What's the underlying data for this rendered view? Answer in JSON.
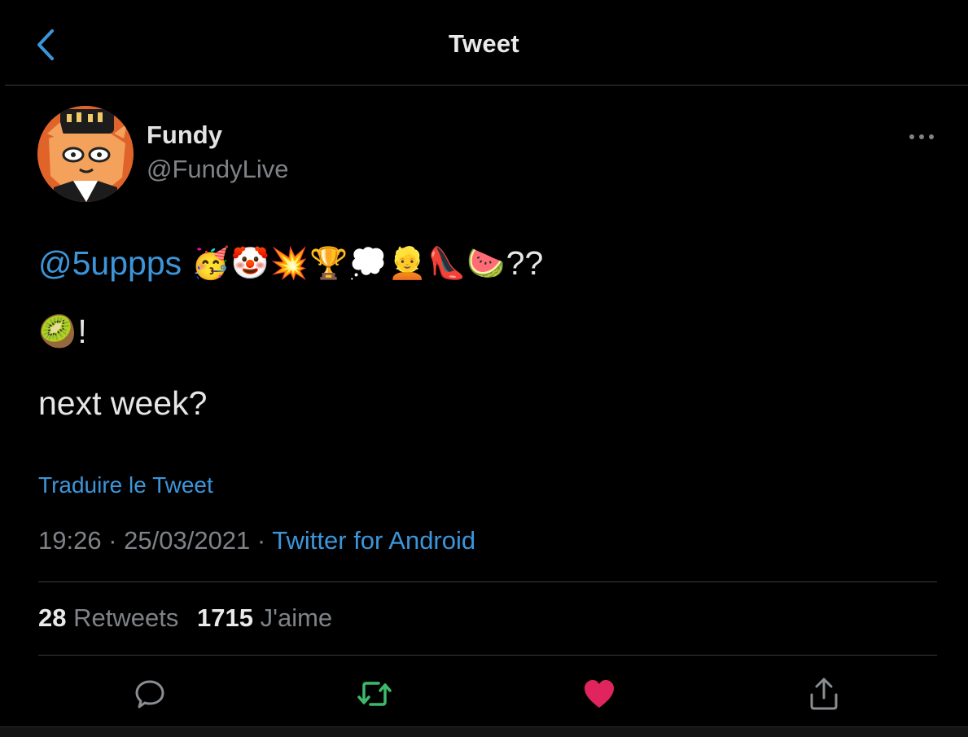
{
  "header": {
    "title": "Tweet",
    "back_icon": "chevron-left-icon"
  },
  "author": {
    "display_name": "Fundy",
    "handle": "@FundyLive",
    "avatar_icon": "fox-avatar",
    "more_icon": "more-horizontal-icon"
  },
  "tweet": {
    "mention": "@5uppps",
    "emoji_line": "🥳🤡💥🏆💭👱👠🍉",
    "line1_suffix": "??",
    "line2_emoji": "🥝",
    "line2_suffix": "!",
    "line3": "next week?"
  },
  "translate_label": "Traduire le Tweet",
  "meta": {
    "time": "19:26",
    "separator": " · ",
    "date": "25/03/2021",
    "source": "Twitter for Android"
  },
  "stats": {
    "retweets_count": "28",
    "retweets_label": "Retweets",
    "likes_count": "1715",
    "likes_label": "J'aime"
  },
  "actions": {
    "reply_icon": "reply-icon",
    "retweet_icon": "retweet-icon",
    "like_icon": "heart-icon",
    "share_icon": "share-icon"
  },
  "colors": {
    "accent": "#3d95d9",
    "retweet_green": "#3cba6a",
    "like_red": "#e0245e",
    "muted": "#7f8387",
    "background": "#000000"
  }
}
